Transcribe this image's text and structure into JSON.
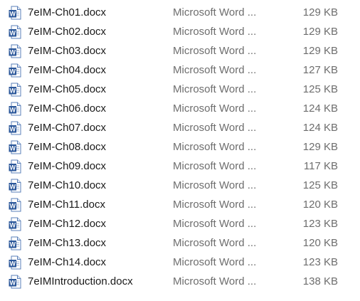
{
  "file_list": {
    "icon": "word-document-icon",
    "colors": {
      "word_blue": "#2b579a",
      "name_text": "#1a1a1a",
      "secondary_text": "#6d6d6d"
    },
    "files": [
      {
        "name": "7eIM-Ch01.docx",
        "type": "Microsoft Word ...",
        "size": "129 KB"
      },
      {
        "name": "7eIM-Ch02.docx",
        "type": "Microsoft Word ...",
        "size": "129 KB"
      },
      {
        "name": "7eIM-Ch03.docx",
        "type": "Microsoft Word ...",
        "size": "129 KB"
      },
      {
        "name": "7eIM-Ch04.docx",
        "type": "Microsoft Word ...",
        "size": "127 KB"
      },
      {
        "name": "7eIM-Ch05.docx",
        "type": "Microsoft Word ...",
        "size": "125 KB"
      },
      {
        "name": "7eIM-Ch06.docx",
        "type": "Microsoft Word ...",
        "size": "124 KB"
      },
      {
        "name": "7eIM-Ch07.docx",
        "type": "Microsoft Word ...",
        "size": "124 KB"
      },
      {
        "name": "7eIM-Ch08.docx",
        "type": "Microsoft Word ...",
        "size": "129 KB"
      },
      {
        "name": "7eIM-Ch09.docx",
        "type": "Microsoft Word ...",
        "size": "117 KB"
      },
      {
        "name": "7eIM-Ch10.docx",
        "type": "Microsoft Word ...",
        "size": "125 KB"
      },
      {
        "name": "7eIM-Ch11.docx",
        "type": "Microsoft Word ...",
        "size": "120 KB"
      },
      {
        "name": "7eIM-Ch12.docx",
        "type": "Microsoft Word ...",
        "size": "123 KB"
      },
      {
        "name": "7eIM-Ch13.docx",
        "type": "Microsoft Word ...",
        "size": "120 KB"
      },
      {
        "name": "7eIM-Ch14.docx",
        "type": "Microsoft Word ...",
        "size": "123 KB"
      },
      {
        "name": "7eIMIntroduction.docx",
        "type": "Microsoft Word ...",
        "size": "138 KB"
      }
    ]
  }
}
